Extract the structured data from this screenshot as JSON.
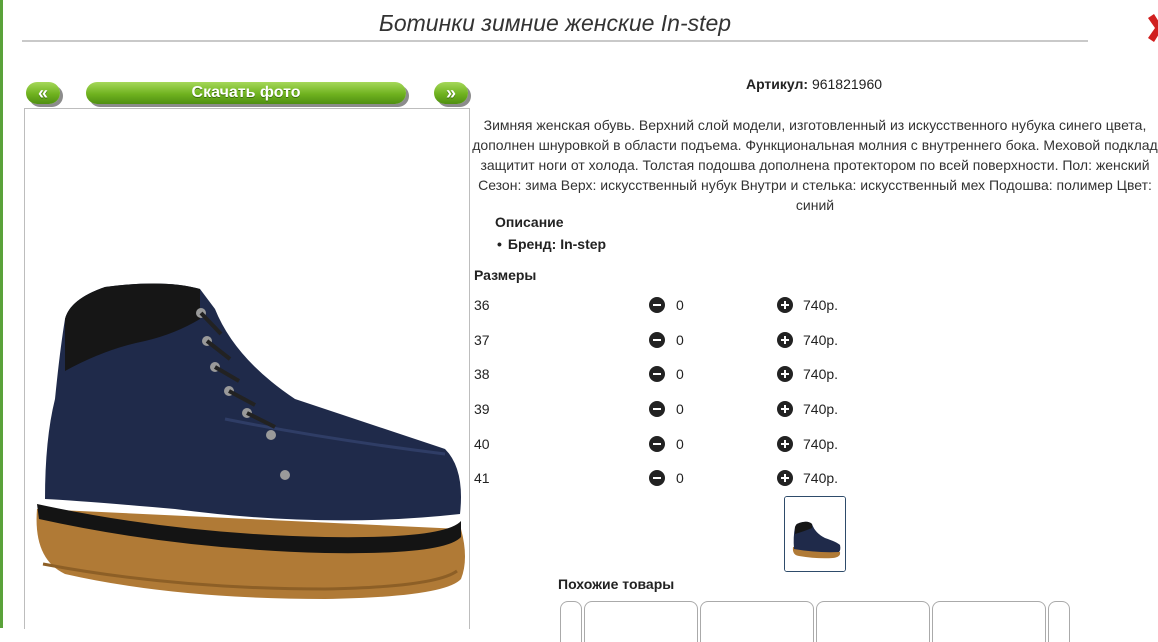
{
  "title": "Ботинки зимние женские In-step",
  "gallery": {
    "prev_label": "«",
    "download_label": "Скачать фото",
    "next_label": "»"
  },
  "article": {
    "label": "Артикул:",
    "value": "961821960"
  },
  "description": "Зимняя женская обувь. Верхний слой модели, изготовленный из искусственного нубука синего цвета, дополнен шнуровкой в области подъема. Функциональная молния с внутреннего бока. Меховой подклад защитит ноги от холода. Толстая подошва дополнена протектором по всей поверхности. Пол: женский Сезон: зима Верх: искусственный нубук Внутри и стелька: искусственный мех Подошва: полимер Цвет: синий",
  "description_heading": "Описание",
  "brand": "Бренд: In-step",
  "sizes_heading": "Размеры",
  "sizes": [
    {
      "size": "36",
      "qty": "0",
      "price": "740р."
    },
    {
      "size": "37",
      "qty": "0",
      "price": "740р."
    },
    {
      "size": "38",
      "qty": "0",
      "price": "740р."
    },
    {
      "size": "39",
      "qty": "0",
      "price": "740р."
    },
    {
      "size": "40",
      "qty": "0",
      "price": "740р."
    },
    {
      "size": "41",
      "qty": "0",
      "price": "740р."
    }
  ],
  "similar_heading": "Похожие товары",
  "colors": {
    "accent_green": "#6fb21f",
    "boot_navy": "#1f2a4a",
    "sole": "#b07a36"
  }
}
